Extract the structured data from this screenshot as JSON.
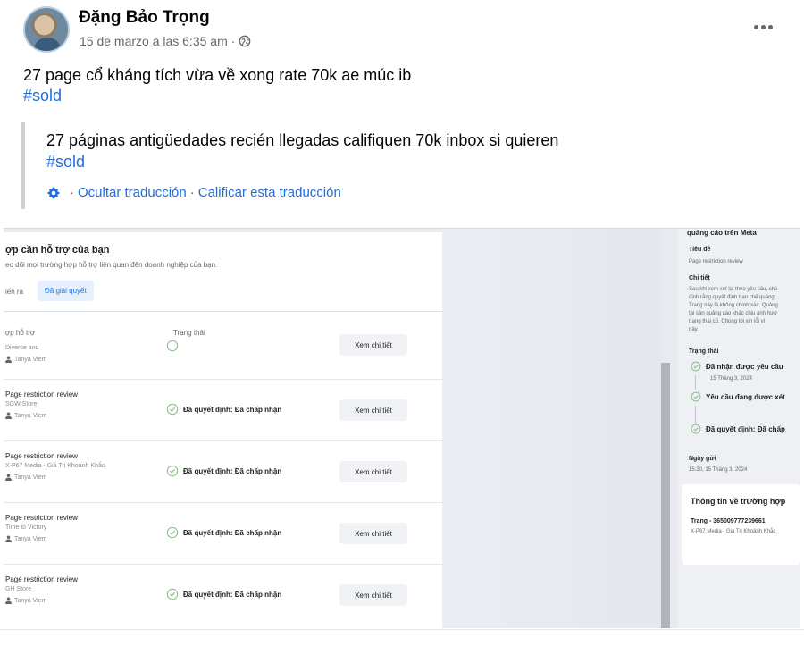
{
  "post": {
    "author": "Đặng Bảo Trọng",
    "timestamp": "15 de marzo a las 6:35 am",
    "meta_separator": "·",
    "text": "27 page cổ kháng tích vừa về xong rate 70k ae múc ib",
    "hashtag": "#sold"
  },
  "translation": {
    "text": "27 páginas antigüedades recién llegadas califiquen 70k inbox si quieren",
    "hashtag": "#sold",
    "hide_label": "Ocultar traducción",
    "separator": "·",
    "rate_label": "Calificar esta traducción"
  },
  "screenshot": {
    "left": {
      "title": "ợp cần hỗ trợ của bạn",
      "subtitle": "eo dõi mọi trường hợp hỗ trợ liên quan đến doanh nghiệp của bạn.",
      "tab_in_progress": "iến ra",
      "tab_resolved": "Đã giải quyết",
      "col_case": "ợp hỗ trợ",
      "col_status": "Trạng thái",
      "rows": [
        {
          "title": "",
          "sub": "Diverse and",
          "owner": "Tanya Viem",
          "status": "",
          "button": "Xem chi tiết"
        },
        {
          "title": "Page restriction review",
          "sub": "SGW Store",
          "owner": "Tanya Viem",
          "status": "Đã quyết định: Đã chấp nhận",
          "button": "Xem chi tiết"
        },
        {
          "title": "Page restriction review",
          "sub": "X-P67 Media - Giá Trị Khoảnh Khắc",
          "owner": "Tanya Viem",
          "status": "Đã quyết định: Đã chấp nhận",
          "button": "Xem chi tiết"
        },
        {
          "title": "Page restriction review",
          "sub": "Time to Victory",
          "owner": "Tanya Viem",
          "status": "Đã quyết định: Đã chấp nhận",
          "button": "Xem chi tiết"
        },
        {
          "title": "Page restriction review",
          "sub": "GH Store",
          "owner": "Tanya Viem",
          "status": "Đã quyết định: Đã chấp nhận",
          "button": "Xem chi tiết"
        }
      ]
    },
    "right": {
      "heading": "quảng cáo trên Meta",
      "subject_label": "Tiêu đề",
      "subject_value": "Page restriction review",
      "detail_label": "Chi tiết",
      "detail_lines": [
        "Sau khi xem xét lại theo yêu cầu, chú",
        "định rằng quyết định hạn chế quảng",
        "Trang này là không chính xác. Quảng",
        "tài sản quảng cáo khác chịu ảnh hưở",
        "trạng thái cũ. Chúng tôi xin lỗi vì",
        "này."
      ],
      "status_label": "Trạng thái",
      "steps": [
        {
          "label": "Đã nhận được yêu cầu",
          "date": "15 Tháng 3, 2024"
        },
        {
          "label": "Yêu cầu đang được xét",
          "date": ""
        },
        {
          "label": "Đã quyết định: Đã chấp",
          "date": ""
        }
      ],
      "sent_label": "Ngày gửi",
      "sent_value": "15:20, 15 Tháng 3, 2024",
      "case_info_title": "Thông tin về trường hợp",
      "case_page": "Trang - 365009777239661",
      "case_meta": "X-P67 Media - Giá Trị Khoảnh Khắc"
    }
  },
  "icons": {
    "privacy": "globe-icon",
    "more": "more-options-icon",
    "translation": "gear-icon",
    "status": "check-circle-icon",
    "owner": "person-icon"
  },
  "colors": {
    "link": "#216fdb",
    "secondary_text": "#65676b",
    "tab_active_bg": "#e7f0fd"
  }
}
